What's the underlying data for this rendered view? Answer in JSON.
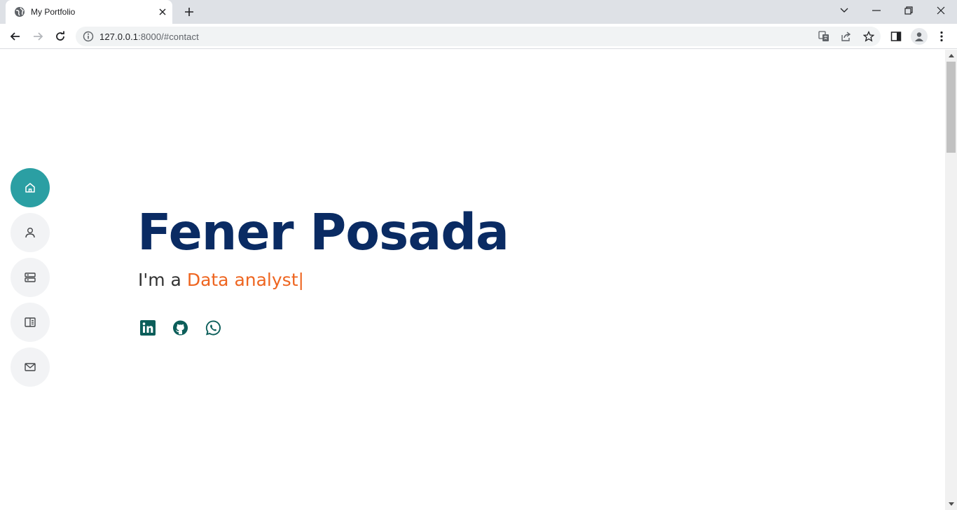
{
  "browser": {
    "tab_title": "My Portfolio",
    "url_host": "127.0.0.1",
    "url_rest": ":8000/#contact"
  },
  "hero": {
    "name": "Fener Posada",
    "prefix": "I'm a ",
    "role": "Data analyst",
    "cursor": "|"
  },
  "nav": {
    "items": [
      {
        "icon": "home-icon",
        "active": true
      },
      {
        "icon": "user-icon",
        "active": false
      },
      {
        "icon": "server-icon",
        "active": false
      },
      {
        "icon": "book-icon",
        "active": false
      },
      {
        "icon": "mail-icon",
        "active": false
      }
    ]
  },
  "social": [
    "linkedin-icon",
    "github-icon",
    "whatsapp-icon"
  ],
  "colors": {
    "accent": "#2b9fa3",
    "name": "#0a2b63",
    "role": "#ee6520",
    "social": "#0c5e5a"
  }
}
